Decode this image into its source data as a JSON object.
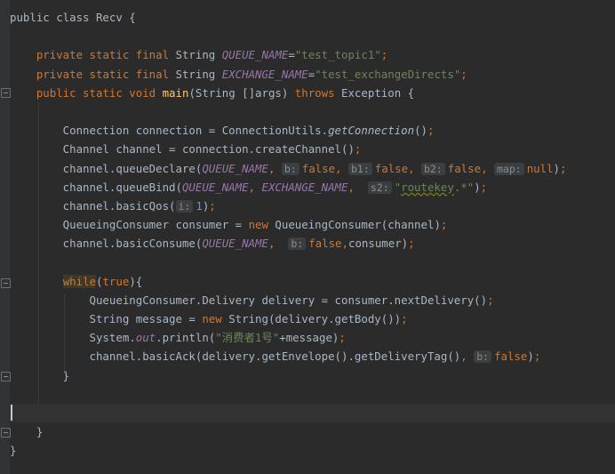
{
  "code_lines": [
    [
      {
        "t": "public class Recv {"
      }
    ],
    [],
    [
      {
        "t": "    "
      },
      {
        "t": "private static final ",
        "c": "kw"
      },
      {
        "t": "String "
      },
      {
        "t": "QUEUE_NAME",
        "c": "fld"
      },
      {
        "t": "="
      },
      {
        "t": "\"test_topic1\"",
        "c": "str"
      },
      {
        "t": ";",
        "c": "kw"
      }
    ],
    [
      {
        "t": "    "
      },
      {
        "t": "private static final ",
        "c": "kw"
      },
      {
        "t": "String "
      },
      {
        "t": "EXCHANGE_NAME",
        "c": "fld"
      },
      {
        "t": "="
      },
      {
        "t": "\"test_exchangeDirects\"",
        "c": "str"
      },
      {
        "t": ";",
        "c": "kw"
      }
    ],
    [
      {
        "t": "    "
      },
      {
        "t": "public static void ",
        "c": "kw"
      },
      {
        "t": "main",
        "c": "fn"
      },
      {
        "t": "(String []args) "
      },
      {
        "t": "throws ",
        "c": "kw"
      },
      {
        "t": "Exception {"
      }
    ],
    [],
    [
      {
        "t": "        Connection connection = ConnectionUtils."
      },
      {
        "t": "getConnection",
        "c": "sm"
      },
      {
        "t": "()"
      },
      {
        "t": ";",
        "c": "kw"
      }
    ],
    [
      {
        "t": "        Channel channel = connection.createChannel()"
      },
      {
        "t": ";",
        "c": "kw"
      }
    ],
    [
      {
        "t": "        channel.queueDeclare("
      },
      {
        "t": "QUEUE_NAME",
        "c": "fld"
      },
      {
        "t": ", ",
        "c": "kw"
      },
      {
        "t": "b:",
        "c": "hint"
      },
      {
        "t": "false",
        "c": "kw"
      },
      {
        "t": ", ",
        "c": "kw"
      },
      {
        "t": "b1:",
        "c": "hint"
      },
      {
        "t": "false",
        "c": "kw"
      },
      {
        "t": ", ",
        "c": "kw"
      },
      {
        "t": "b2:",
        "c": "hint"
      },
      {
        "t": "false",
        "c": "kw"
      },
      {
        "t": ", ",
        "c": "kw"
      },
      {
        "t": "map:",
        "c": "hint"
      },
      {
        "t": "null",
        "c": "kw"
      },
      {
        "t": ")"
      },
      {
        "t": ";",
        "c": "kw"
      }
    ],
    [
      {
        "t": "        channel.queueBind("
      },
      {
        "t": "QUEUE_NAME",
        "c": "fld"
      },
      {
        "t": ", ",
        "c": "kw"
      },
      {
        "t": "EXCHANGE_NAME",
        "c": "fld"
      },
      {
        "t": ",  ",
        "c": "kw"
      },
      {
        "t": "s2:",
        "c": "hint"
      },
      {
        "t": "\"",
        "c": "str"
      },
      {
        "t": "routekey",
        "c": "str squig"
      },
      {
        "t": ".*\"",
        "c": "str"
      },
      {
        "t": ")"
      },
      {
        "t": ";",
        "c": "kw"
      }
    ],
    [
      {
        "t": "        channel.basicQos("
      },
      {
        "t": "i:",
        "c": "hint"
      },
      {
        "t": "1",
        "c": "num"
      },
      {
        "t": ")"
      },
      {
        "t": ";",
        "c": "kw"
      }
    ],
    [
      {
        "t": "        QueueingConsumer consumer = "
      },
      {
        "t": "new ",
        "c": "kw"
      },
      {
        "t": "QueueingConsumer(channel)"
      },
      {
        "t": ";",
        "c": "kw"
      }
    ],
    [
      {
        "t": "        channel.basicConsume("
      },
      {
        "t": "QUEUE_NAME",
        "c": "fld"
      },
      {
        "t": ",  ",
        "c": "kw"
      },
      {
        "t": "b:",
        "c": "hint"
      },
      {
        "t": "false",
        "c": "kw"
      },
      {
        "t": ",",
        "c": "kw"
      },
      {
        "t": "consumer)"
      },
      {
        "t": ";",
        "c": "kw"
      }
    ],
    [],
    [
      {
        "t": "        "
      },
      {
        "t": "while",
        "c": "hl"
      },
      {
        "t": "("
      },
      {
        "t": "true",
        "c": "kw"
      },
      {
        "t": "){"
      }
    ],
    [
      {
        "t": "            QueueingConsumer.Delivery delivery = consumer.nextDelivery()"
      },
      {
        "t": ";",
        "c": "kw"
      }
    ],
    [
      {
        "t": "            String message = "
      },
      {
        "t": "new ",
        "c": "kw"
      },
      {
        "t": "String(delivery.getBody())"
      },
      {
        "t": ";",
        "c": "kw"
      }
    ],
    [
      {
        "t": "            System."
      },
      {
        "t": "out",
        "c": "fld"
      },
      {
        "t": ".println("
      },
      {
        "t": "\"消费者1号\"",
        "c": "str"
      },
      {
        "t": "+message)"
      },
      {
        "t": ";",
        "c": "kw"
      }
    ],
    [
      {
        "t": "            channel.basicAck(delivery.getEnvelope().getDeliveryTag()"
      },
      {
        "t": ", ",
        "c": "kw"
      },
      {
        "t": "b:",
        "c": "hint"
      },
      {
        "t": "false",
        "c": "kw"
      },
      {
        "t": ")"
      },
      {
        "t": ";",
        "c": "kw"
      }
    ],
    [
      {
        "t": "        }"
      }
    ],
    [],
    [],
    [
      {
        "t": "    }"
      }
    ],
    [
      {
        "t": "}"
      }
    ]
  ],
  "current_line": 21
}
